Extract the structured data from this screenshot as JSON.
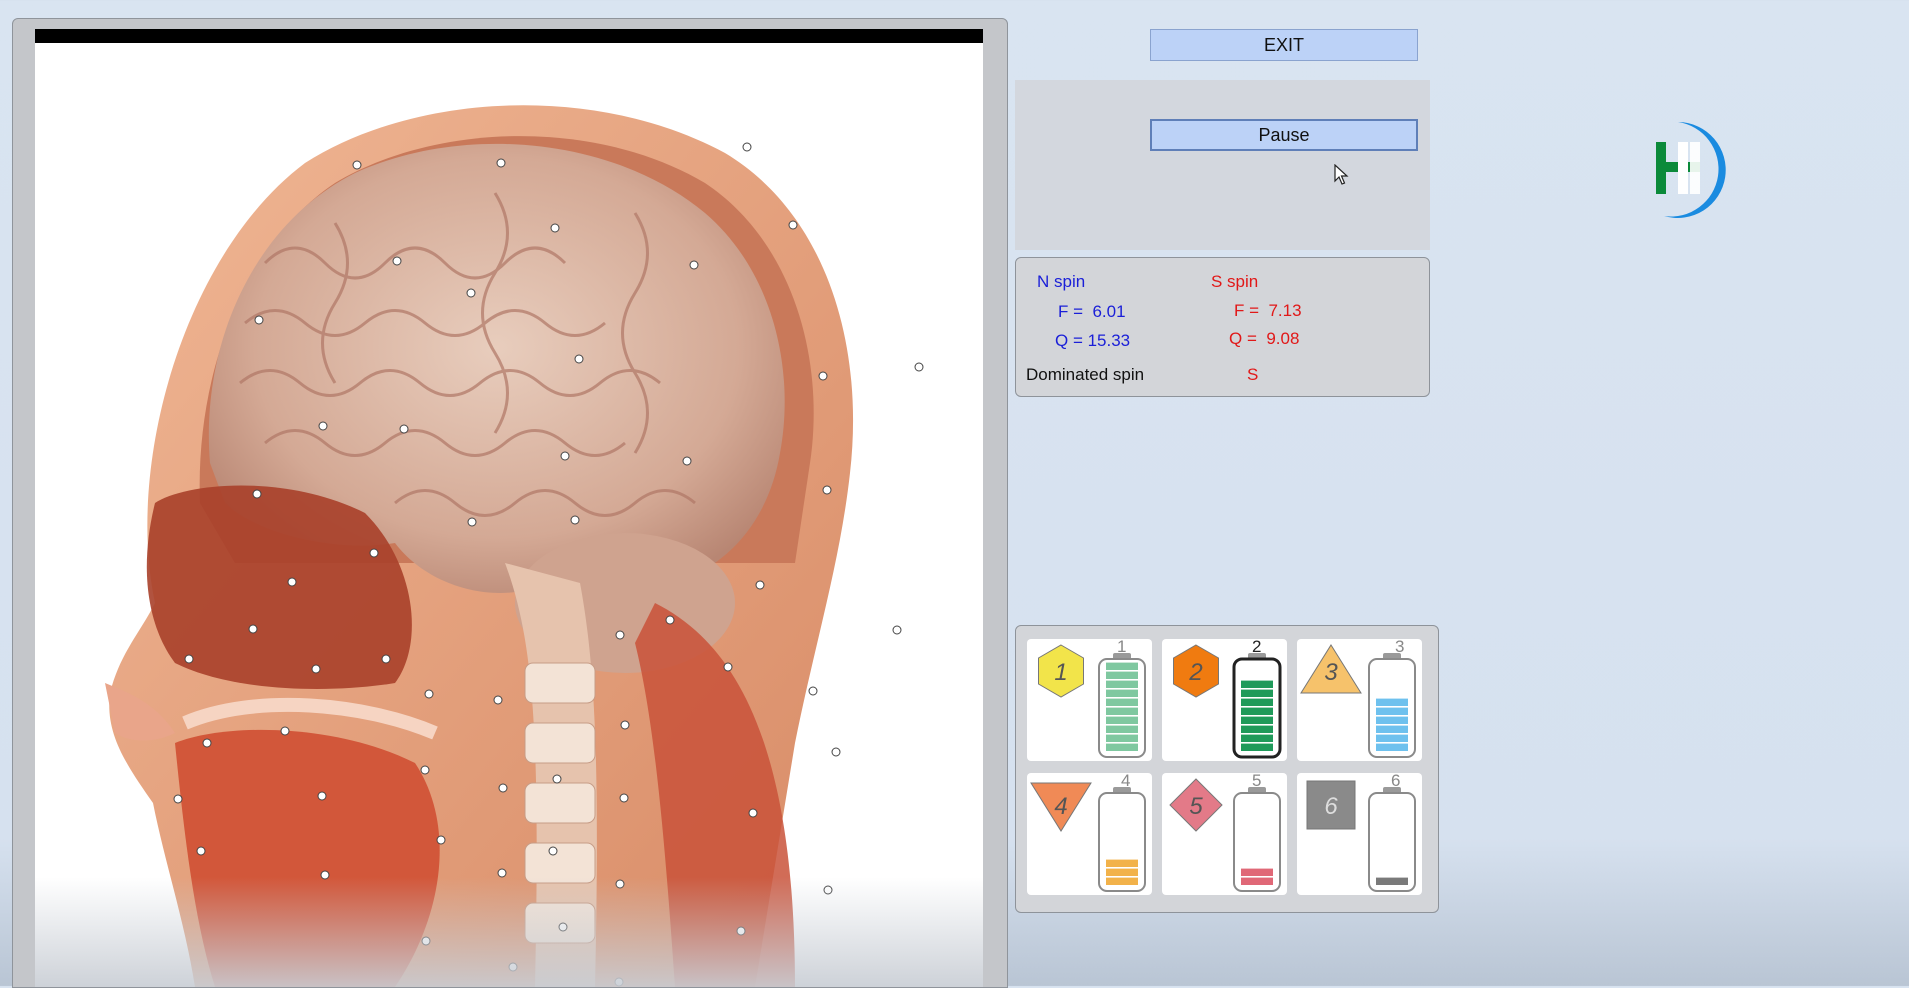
{
  "buttons": {
    "exit_label": "EXIT",
    "pause_label": "Pause"
  },
  "spin": {
    "n_title": "N spin",
    "n_f": "F =  6.01",
    "n_q": "Q = 15.33",
    "s_title": "S spin",
    "s_f": "F =  7.13",
    "s_q": "Q =  9.08",
    "dominated_label": "Dominated spin",
    "dominated_value": "S",
    "colors": {
      "n": "#1a1fd8",
      "s": "#e11818"
    }
  },
  "batteries": [
    {
      "num": "1",
      "badge": "1",
      "shape": "hexagon",
      "color": "#f2e44a",
      "level": 10,
      "fill": "#7fc8a0"
    },
    {
      "num": "2",
      "badge": "2",
      "shape": "hexagon",
      "color": "#f07b10",
      "level": 8,
      "fill": "#1f9a5a"
    },
    {
      "num": "3",
      "badge": "3",
      "shape": "triangle",
      "color": "#f6c26b",
      "level": 6,
      "fill": "#6ec1ee"
    },
    {
      "num": "4",
      "badge": "4",
      "shape": "triangle-down",
      "color": "#f08a56",
      "level": 3,
      "fill": "#f2b24a"
    },
    {
      "num": "5",
      "badge": "5",
      "shape": "diamond",
      "color": "#e37a88",
      "level": 2,
      "fill": "#e06877"
    },
    {
      "num": "6",
      "badge": "6",
      "shape": "square",
      "color": "#8a8a8a",
      "level": 1,
      "fill": "#7a7a7a"
    }
  ],
  "icons": {
    "logo": "ht-logo-icon",
    "cursor": "mouse-pointer-icon"
  }
}
